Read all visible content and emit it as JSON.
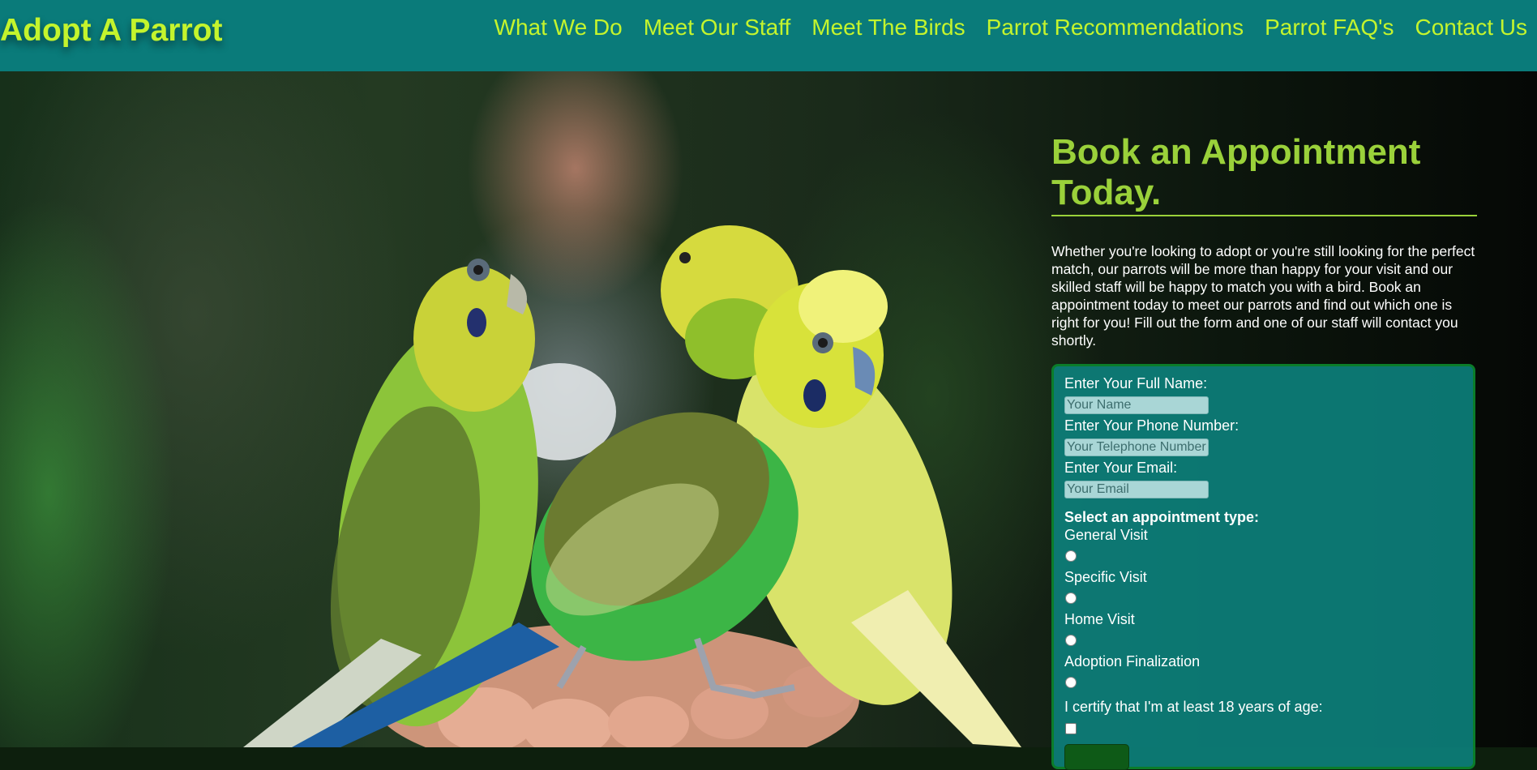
{
  "site": {
    "brand": "Adopt A Parrot"
  },
  "nav": {
    "items": [
      {
        "label": "What We Do"
      },
      {
        "label": "Meet Our Staff"
      },
      {
        "label": "Meet The Birds"
      },
      {
        "label": "Parrot Recommendations"
      },
      {
        "label": "Parrot FAQ's"
      },
      {
        "label": "Contact Us"
      }
    ]
  },
  "colors": {
    "header": "#0a7b7a",
    "accent": "#c4f42d",
    "heading": "#9ad13a",
    "form_bg": "#0c8480"
  },
  "appointment": {
    "heading": "Book an Appointment Today.",
    "intro": "Whether you're looking to adopt or you're still looking for the perfect match, our parrots will be more than happy for your visit and our skilled staff will be happy to match you with a bird. Book an appointment today to meet our parrots and find out which one is right for you! Fill out the form and one of our staff will contact you shortly.",
    "form": {
      "name_label": "Enter Your Full Name:",
      "name_placeholder": "Your Name",
      "phone_label": "Enter Your Phone Number:",
      "phone_placeholder": "Your Telephone Number",
      "email_label": "Enter Your Email:",
      "email_placeholder": "Your Email",
      "type_title": "Select an appointment type:",
      "types": [
        {
          "label": "General Visit"
        },
        {
          "label": "Specific Visit"
        },
        {
          "label": "Home Visit"
        },
        {
          "label": "Adoption Finalization"
        }
      ],
      "certify_label": "I certify that I'm at least 18 years of age:"
    }
  }
}
